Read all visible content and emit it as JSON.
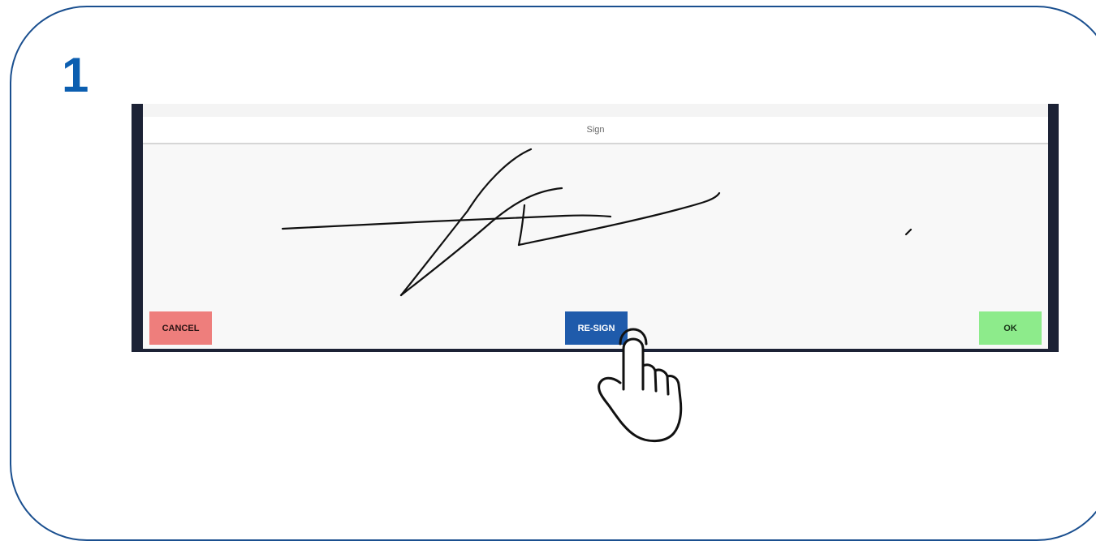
{
  "step": {
    "number": "1"
  },
  "dialog": {
    "title": "Sign"
  },
  "buttons": {
    "cancel_label": "CANCEL",
    "resign_label": "RE-SIGN",
    "ok_label": "OK"
  },
  "colors": {
    "frame_border": "#1a4f8f",
    "step_number": "#0b5eb0",
    "cancel_bg": "#ee7e7c",
    "resign_bg": "#1f5bab",
    "ok_bg": "#8deb8b"
  },
  "icons": {
    "pointer": "hand-pointer-icon"
  }
}
